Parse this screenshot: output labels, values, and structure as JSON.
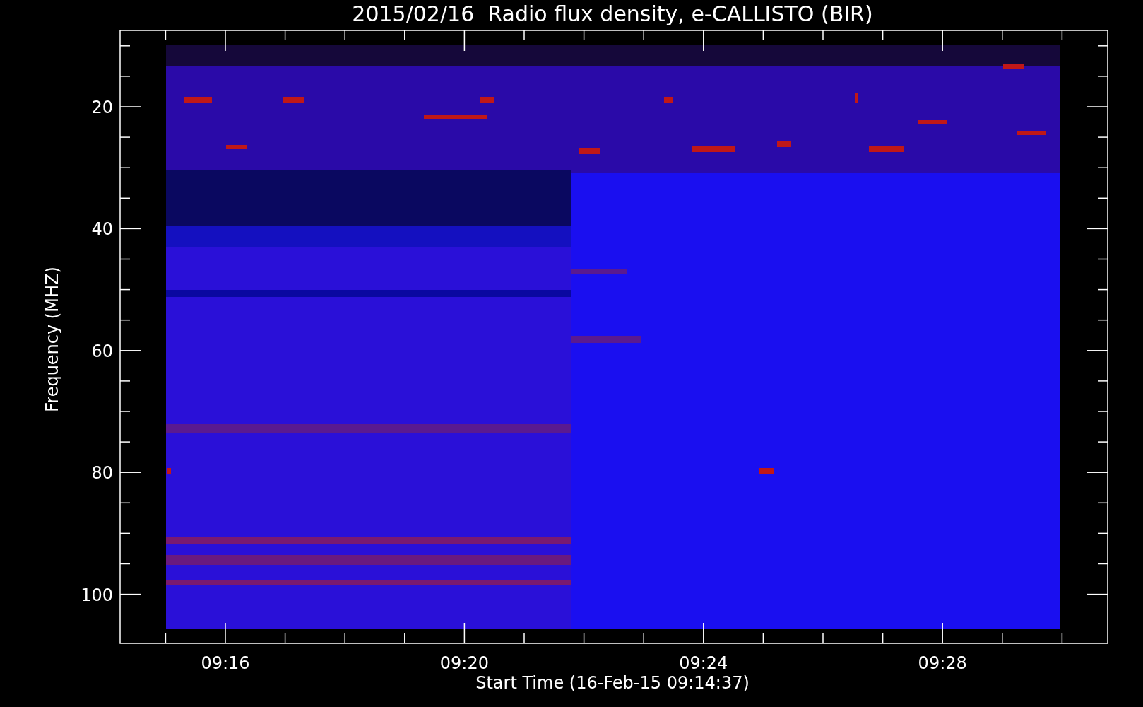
{
  "title": "2015/02/16  Radio flux density, e-CALLISTO (BIR)",
  "y_axis": {
    "label": "Frequency (MHZ)",
    "ticks": [
      "20",
      "40",
      "60",
      "80",
      "100"
    ]
  },
  "x_axis": {
    "label": "Start Time (16-Feb-15 09:14:37)",
    "ticks": [
      "09:16",
      "09:20",
      "09:24",
      "09:28"
    ]
  }
}
